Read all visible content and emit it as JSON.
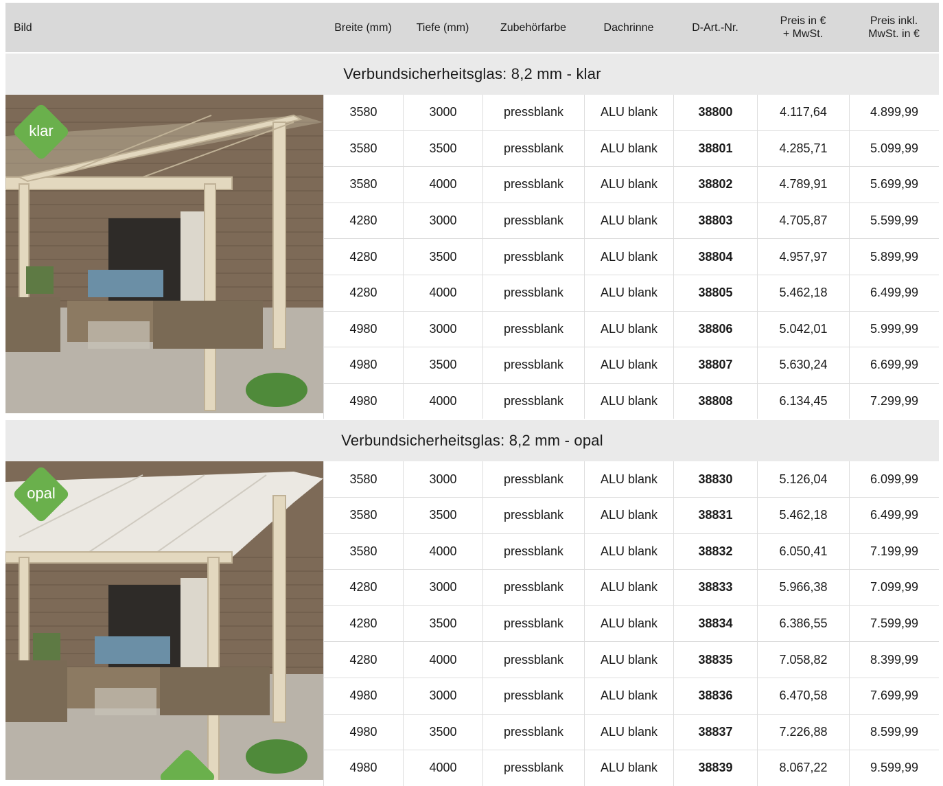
{
  "header": {
    "bild": "Bild",
    "breite": "Breite (mm)",
    "tiefe": "Tiefe (mm)",
    "zubehoer": "Zubehörfarbe",
    "dachrinne": "Dachrinne",
    "artnr": "D-Art.-Nr.",
    "preis_netto": "Preis in €\n+ MwSt.",
    "preis_brutto": "Preis inkl.\nMwSt. in €"
  },
  "sections": [
    {
      "title": "Verbundsicherheitsglas: 8,2 mm - klar",
      "badge": "klar",
      "rows": [
        [
          "3580",
          "3000",
          "pressblank",
          "ALU blank",
          "38800",
          "4.117,64",
          "4.899,99"
        ],
        [
          "3580",
          "3500",
          "pressblank",
          "ALU blank",
          "38801",
          "4.285,71",
          "5.099,99"
        ],
        [
          "3580",
          "4000",
          "pressblank",
          "ALU blank",
          "38802",
          "4.789,91",
          "5.699,99"
        ],
        [
          "4280",
          "3000",
          "pressblank",
          "ALU blank",
          "38803",
          "4.705,87",
          "5.599,99"
        ],
        [
          "4280",
          "3500",
          "pressblank",
          "ALU blank",
          "38804",
          "4.957,97",
          "5.899,99"
        ],
        [
          "4280",
          "4000",
          "pressblank",
          "ALU blank",
          "38805",
          "5.462,18",
          "6.499,99"
        ],
        [
          "4980",
          "3000",
          "pressblank",
          "ALU blank",
          "38806",
          "5.042,01",
          "5.999,99"
        ],
        [
          "4980",
          "3500",
          "pressblank",
          "ALU blank",
          "38807",
          "5.630,24",
          "6.699,99"
        ],
        [
          "4980",
          "4000",
          "pressblank",
          "ALU blank",
          "38808",
          "6.134,45",
          "7.299,99"
        ]
      ]
    },
    {
      "title": "Verbundsicherheitsglas: 8,2 mm - opal",
      "badge": "opal",
      "rows": [
        [
          "3580",
          "3000",
          "pressblank",
          "ALU blank",
          "38830",
          "5.126,04",
          "6.099,99"
        ],
        [
          "3580",
          "3500",
          "pressblank",
          "ALU blank",
          "38831",
          "5.462,18",
          "6.499,99"
        ],
        [
          "3580",
          "4000",
          "pressblank",
          "ALU blank",
          "38832",
          "6.050,41",
          "7.199,99"
        ],
        [
          "4280",
          "3000",
          "pressblank",
          "ALU blank",
          "38833",
          "5.966,38",
          "7.099,99"
        ],
        [
          "4280",
          "3500",
          "pressblank",
          "ALU blank",
          "38834",
          "6.386,55",
          "7.599,99"
        ],
        [
          "4280",
          "4000",
          "pressblank",
          "ALU blank",
          "38835",
          "7.058,82",
          "8.399,99"
        ],
        [
          "4980",
          "3000",
          "pressblank",
          "ALU blank",
          "38836",
          "6.470,58",
          "7.699,99"
        ],
        [
          "4980",
          "3500",
          "pressblank",
          "ALU blank",
          "38837",
          "7.226,88",
          "8.599,99"
        ],
        [
          "4980",
          "4000",
          "pressblank",
          "ALU blank",
          "38839",
          "8.067,22",
          "9.599,99"
        ]
      ]
    }
  ],
  "colors": {
    "badge": "#6ab04c",
    "header_bg": "#d9d9d9",
    "section_bg": "#eaeaea"
  },
  "icons": {
    "photo_klar": "pergola-clear-roof-photo",
    "photo_opal": "pergola-opal-roof-photo"
  }
}
